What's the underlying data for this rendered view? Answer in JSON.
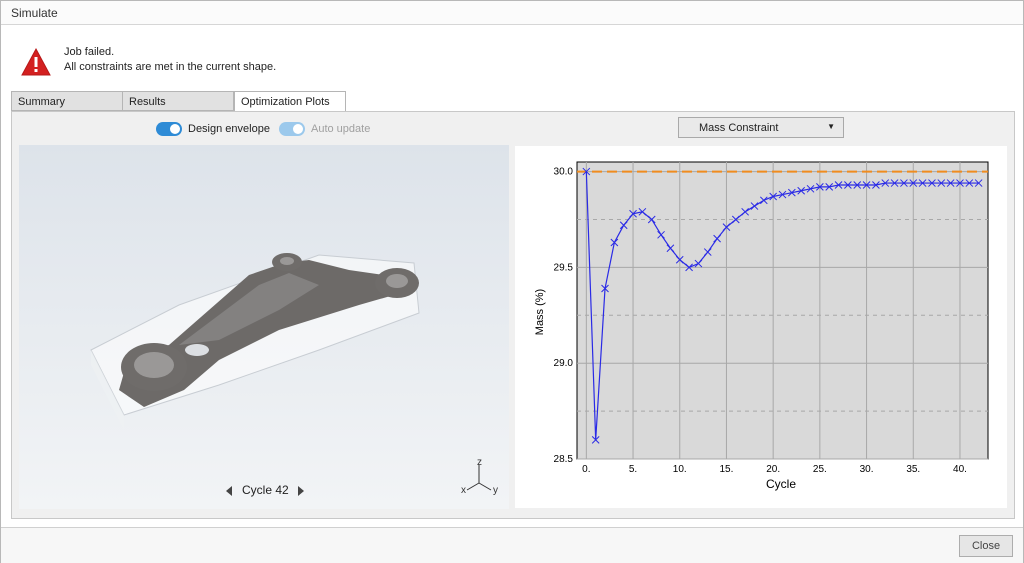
{
  "window": {
    "title": "Simulate"
  },
  "message": {
    "icon": "warning-icon",
    "line1": "Job failed.",
    "line2": "All constraints are met in the current shape."
  },
  "tabs": [
    {
      "label": "Summary",
      "active": false
    },
    {
      "label": "Results",
      "active": false
    },
    {
      "label": "Optimization Plots",
      "active": true
    }
  ],
  "controls": {
    "design_envelope": {
      "label": "Design envelope",
      "on": true
    },
    "auto_update": {
      "label": "Auto update",
      "on": true,
      "disabled": true
    },
    "plot_select": {
      "value": "Mass Constraint"
    }
  },
  "viewport": {
    "cycle_label": "Cycle 42",
    "prev_icon": "triangle-left-icon",
    "next_icon": "triangle-right-icon",
    "axes": {
      "z": "z",
      "x": "x",
      "y": "y"
    }
  },
  "footer": {
    "close_label": "Close"
  },
  "colors": {
    "toggle_on": "#2e8bd6",
    "toggle_disabled": "#9cc9ec",
    "series": "#2a2ae6",
    "constraint": "#f08c1e",
    "plot_bg": "#d9d9d9",
    "warning": "#d32020"
  },
  "chart_data": {
    "type": "line",
    "xlabel": "Cycle",
    "ylabel": "Mass (%)",
    "xlim": [
      -1,
      43
    ],
    "ylim": [
      28.5,
      30.05
    ],
    "xticks": [
      0,
      5,
      10,
      15,
      20,
      25,
      30,
      35,
      40
    ],
    "xtick_labels": [
      "0.",
      "5.",
      "10.",
      "15.",
      "20.",
      "25.",
      "30.",
      "35.",
      "40."
    ],
    "yticks": [
      28.5,
      29.0,
      29.5,
      30.0
    ],
    "ytick_labels": [
      "28.5",
      "29.0",
      "29.5",
      "30.0"
    ],
    "grid": true,
    "constraint_line": {
      "y": 30.0,
      "style": "dashed"
    },
    "series": [
      {
        "marker": "x",
        "x": [
          0,
          1,
          2,
          3,
          4,
          5,
          6,
          7,
          8,
          9,
          10,
          11,
          12,
          13,
          14,
          15,
          16,
          17,
          18,
          19,
          20,
          21,
          22,
          23,
          24,
          25,
          26,
          27,
          28,
          29,
          30,
          31,
          32,
          33,
          34,
          35,
          36,
          37,
          38,
          39,
          40,
          41,
          42
        ],
        "y": [
          30.0,
          28.6,
          29.39,
          29.63,
          29.72,
          29.78,
          29.79,
          29.75,
          29.67,
          29.6,
          29.54,
          29.5,
          29.52,
          29.58,
          29.65,
          29.71,
          29.75,
          29.79,
          29.82,
          29.85,
          29.87,
          29.88,
          29.89,
          29.9,
          29.91,
          29.92,
          29.92,
          29.93,
          29.93,
          29.93,
          29.93,
          29.93,
          29.94,
          29.94,
          29.94,
          29.94,
          29.94,
          29.94,
          29.94,
          29.94,
          29.94,
          29.94,
          29.94
        ]
      }
    ]
  }
}
